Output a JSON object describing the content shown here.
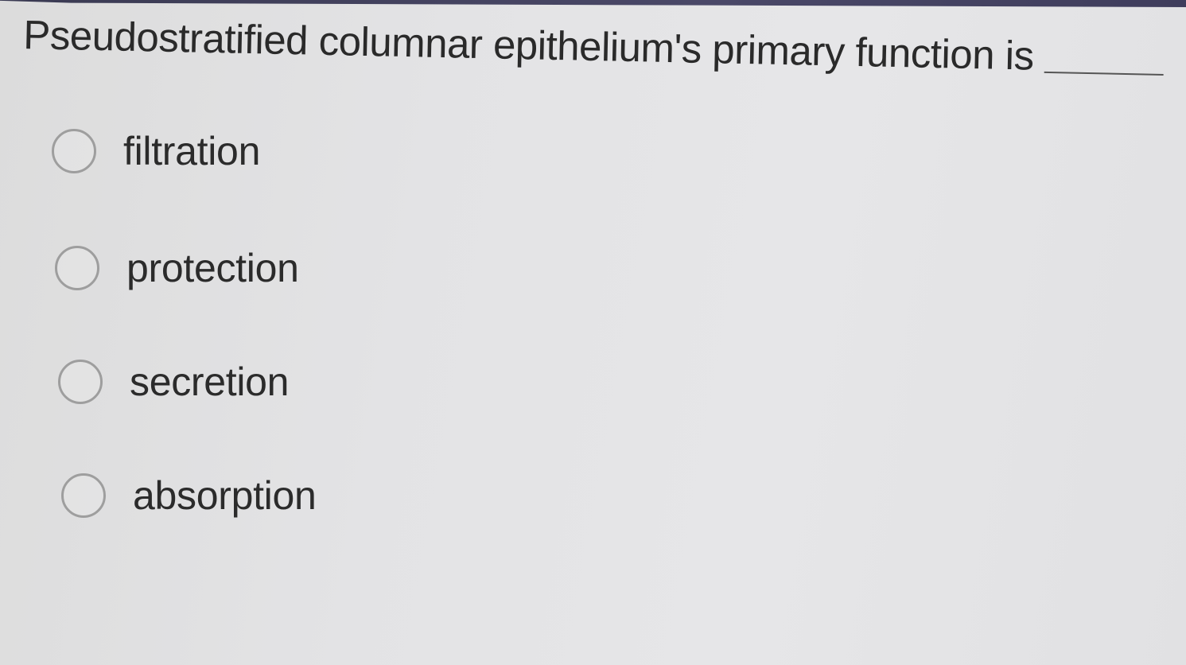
{
  "question": {
    "text": "Pseudostratified columnar epithelium's primary function is"
  },
  "options": [
    {
      "label": "filtration",
      "selected": false
    },
    {
      "label": "protection",
      "selected": false
    },
    {
      "label": "secretion",
      "selected": false
    },
    {
      "label": "absorption",
      "selected": false
    }
  ]
}
